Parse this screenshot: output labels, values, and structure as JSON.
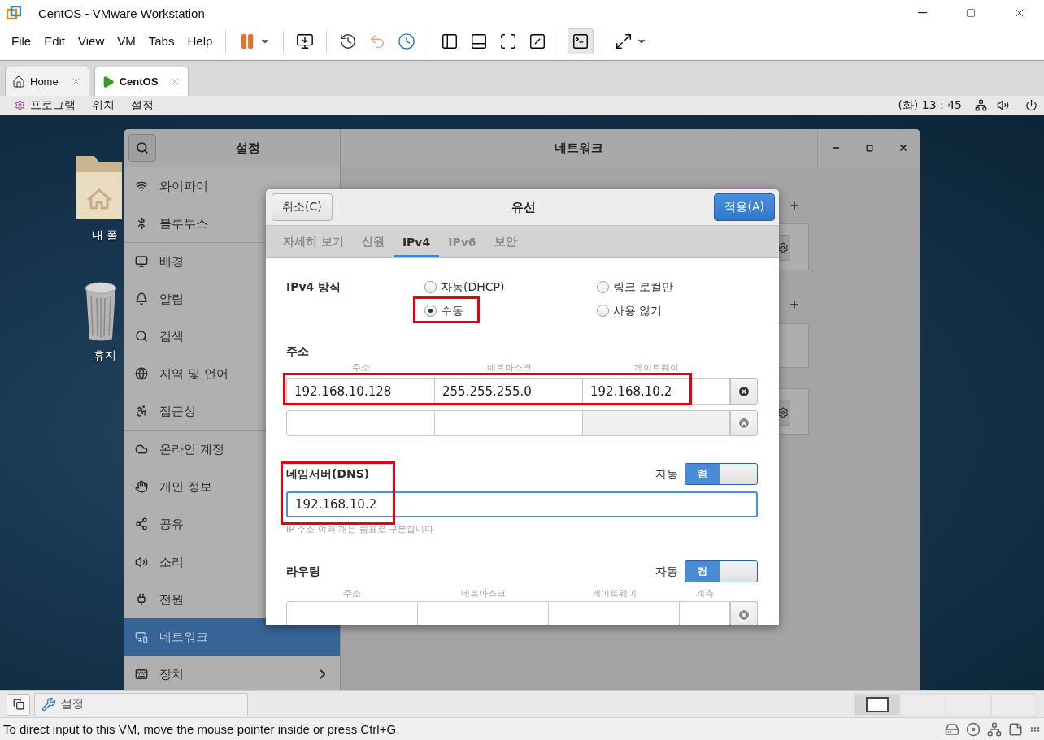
{
  "window": {
    "title": "CentOS - VMware Workstation"
  },
  "menu": [
    "File",
    "Edit",
    "View",
    "VM",
    "Tabs",
    "Help"
  ],
  "toolbar": [
    {
      "pressed": false
    },
    {
      "pressed": false
    },
    {
      "pressed": false
    },
    {
      "pressed": false
    },
    {
      "pressed": false
    },
    {
      "pressed": false
    },
    {
      "pressed": false
    },
    {
      "pressed": false
    },
    {
      "pressed": false
    },
    {
      "pressed": true
    },
    {
      "pressed": false
    }
  ],
  "vm_tabs": [
    {
      "label": "Home",
      "selected": false
    },
    {
      "label": "CentOS",
      "selected": true
    }
  ],
  "gnome_bar": {
    "menus": [
      "프로그램",
      "위치",
      "설정"
    ],
    "clock": "(화) 13 : 45"
  },
  "desktop": {
    "icons": [
      {
        "label": "내 폴"
      },
      {
        "label": "휴지"
      }
    ]
  },
  "settings": {
    "title": "설정",
    "pane_title": "네트워크",
    "sidebar": [
      [
        {
          "label": "와이파이",
          "selected": false,
          "kind": "page"
        },
        {
          "label": "블루투스",
          "selected": false,
          "kind": "page"
        }
      ],
      [
        {
          "label": "배경",
          "selected": false,
          "kind": "page"
        },
        {
          "label": "알림",
          "selected": false,
          "kind": "page"
        },
        {
          "label": "검색",
          "selected": false,
          "kind": "page"
        },
        {
          "label": "지역 및 언어",
          "selected": false,
          "kind": "page"
        },
        {
          "label": "접근성",
          "selected": false,
          "kind": "page"
        }
      ],
      [
        {
          "label": "온라인 계정",
          "selected": false,
          "kind": "page"
        },
        {
          "label": "개인 정보",
          "selected": false,
          "kind": "page"
        },
        {
          "label": "공유",
          "selected": false,
          "kind": "page"
        }
      ],
      [
        {
          "label": "소리",
          "selected": false,
          "kind": "page"
        },
        {
          "label": "전원",
          "selected": false,
          "kind": "page"
        },
        {
          "label": "네트워크",
          "selected": true,
          "kind": "page"
        },
        {
          "label": "장치",
          "selected": false,
          "kind": "submenu"
        }
      ]
    ]
  },
  "dialog": {
    "title": "유선",
    "cancel": "취소(C)",
    "apply": "적용(A)",
    "tabs": [
      {
        "label": "자세히 보기",
        "selected": false
      },
      {
        "label": "신원",
        "selected": false
      },
      {
        "label": "IPv4",
        "selected": true
      },
      {
        "label": "IPv6",
        "selected": false
      },
      {
        "label": "보안",
        "selected": false
      }
    ],
    "method": {
      "label": "IPv4 방식",
      "options": [
        {
          "label": "자동(DHCP)",
          "selected": false
        },
        {
          "label": "링크 로컬만",
          "selected": false
        },
        {
          "label": "수동",
          "selected": true
        },
        {
          "label": "사용 않기",
          "selected": false
        }
      ]
    },
    "addresses": {
      "label": "주소",
      "columns": [
        "주소",
        "네트마스크",
        "게이트웨이"
      ],
      "rows": [
        {
          "cells": [
            {
              "value": "192.168.10.128",
              "disabled": false
            },
            {
              "value": "255.255.255.0",
              "disabled": false
            },
            {
              "value": "192.168.10.2",
              "disabled": false
            }
          ]
        },
        {
          "cells": [
            {
              "disabled": false
            },
            {
              "disabled": false
            },
            {
              "disabled": true
            }
          ]
        }
      ]
    },
    "dns": {
      "label": "네임서버(DNS)",
      "auto_label": "자동",
      "toggle": {
        "label": "켬",
        "on": true
      },
      "value": "192.168.10.2",
      "focused": true,
      "hint": "IP 주소 여러 개는 쉼표로 구분합니다"
    },
    "routes": {
      "label": "라우팅",
      "auto_label": "자동",
      "toggle": {
        "label": "켬",
        "on": true
      },
      "columns": [
        "주소",
        "네트마스크",
        "게이트웨이",
        "계측"
      ]
    }
  },
  "vm_taskbar": {
    "task": "설정",
    "workspaces": [
      {
        "selected": true
      },
      {
        "selected": false
      },
      {
        "selected": false
      },
      {
        "selected": false
      }
    ]
  },
  "status_bar": {
    "message": "To direct input to this VM, move the mouse pointer inside or press Ctrl+G."
  }
}
